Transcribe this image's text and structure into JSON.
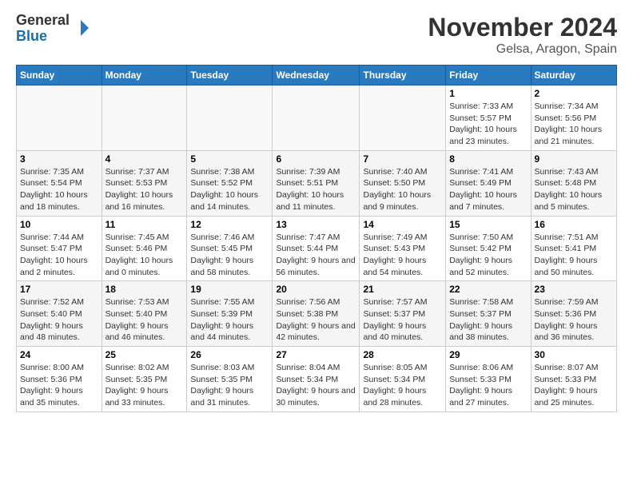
{
  "logo": {
    "general": "General",
    "blue": "Blue"
  },
  "title": "November 2024",
  "subtitle": "Gelsa, Aragon, Spain",
  "days_of_week": [
    "Sunday",
    "Monday",
    "Tuesday",
    "Wednesday",
    "Thursday",
    "Friday",
    "Saturday"
  ],
  "weeks": [
    [
      {
        "day": "",
        "info": ""
      },
      {
        "day": "",
        "info": ""
      },
      {
        "day": "",
        "info": ""
      },
      {
        "day": "",
        "info": ""
      },
      {
        "day": "",
        "info": ""
      },
      {
        "day": "1",
        "info": "Sunrise: 7:33 AM\nSunset: 5:57 PM\nDaylight: 10 hours and 23 minutes."
      },
      {
        "day": "2",
        "info": "Sunrise: 7:34 AM\nSunset: 5:56 PM\nDaylight: 10 hours and 21 minutes."
      }
    ],
    [
      {
        "day": "3",
        "info": "Sunrise: 7:35 AM\nSunset: 5:54 PM\nDaylight: 10 hours and 18 minutes."
      },
      {
        "day": "4",
        "info": "Sunrise: 7:37 AM\nSunset: 5:53 PM\nDaylight: 10 hours and 16 minutes."
      },
      {
        "day": "5",
        "info": "Sunrise: 7:38 AM\nSunset: 5:52 PM\nDaylight: 10 hours and 14 minutes."
      },
      {
        "day": "6",
        "info": "Sunrise: 7:39 AM\nSunset: 5:51 PM\nDaylight: 10 hours and 11 minutes."
      },
      {
        "day": "7",
        "info": "Sunrise: 7:40 AM\nSunset: 5:50 PM\nDaylight: 10 hours and 9 minutes."
      },
      {
        "day": "8",
        "info": "Sunrise: 7:41 AM\nSunset: 5:49 PM\nDaylight: 10 hours and 7 minutes."
      },
      {
        "day": "9",
        "info": "Sunrise: 7:43 AM\nSunset: 5:48 PM\nDaylight: 10 hours and 5 minutes."
      }
    ],
    [
      {
        "day": "10",
        "info": "Sunrise: 7:44 AM\nSunset: 5:47 PM\nDaylight: 10 hours and 2 minutes."
      },
      {
        "day": "11",
        "info": "Sunrise: 7:45 AM\nSunset: 5:46 PM\nDaylight: 10 hours and 0 minutes."
      },
      {
        "day": "12",
        "info": "Sunrise: 7:46 AM\nSunset: 5:45 PM\nDaylight: 9 hours and 58 minutes."
      },
      {
        "day": "13",
        "info": "Sunrise: 7:47 AM\nSunset: 5:44 PM\nDaylight: 9 hours and 56 minutes."
      },
      {
        "day": "14",
        "info": "Sunrise: 7:49 AM\nSunset: 5:43 PM\nDaylight: 9 hours and 54 minutes."
      },
      {
        "day": "15",
        "info": "Sunrise: 7:50 AM\nSunset: 5:42 PM\nDaylight: 9 hours and 52 minutes."
      },
      {
        "day": "16",
        "info": "Sunrise: 7:51 AM\nSunset: 5:41 PM\nDaylight: 9 hours and 50 minutes."
      }
    ],
    [
      {
        "day": "17",
        "info": "Sunrise: 7:52 AM\nSunset: 5:40 PM\nDaylight: 9 hours and 48 minutes."
      },
      {
        "day": "18",
        "info": "Sunrise: 7:53 AM\nSunset: 5:40 PM\nDaylight: 9 hours and 46 minutes."
      },
      {
        "day": "19",
        "info": "Sunrise: 7:55 AM\nSunset: 5:39 PM\nDaylight: 9 hours and 44 minutes."
      },
      {
        "day": "20",
        "info": "Sunrise: 7:56 AM\nSunset: 5:38 PM\nDaylight: 9 hours and 42 minutes."
      },
      {
        "day": "21",
        "info": "Sunrise: 7:57 AM\nSunset: 5:37 PM\nDaylight: 9 hours and 40 minutes."
      },
      {
        "day": "22",
        "info": "Sunrise: 7:58 AM\nSunset: 5:37 PM\nDaylight: 9 hours and 38 minutes."
      },
      {
        "day": "23",
        "info": "Sunrise: 7:59 AM\nSunset: 5:36 PM\nDaylight: 9 hours and 36 minutes."
      }
    ],
    [
      {
        "day": "24",
        "info": "Sunrise: 8:00 AM\nSunset: 5:36 PM\nDaylight: 9 hours and 35 minutes."
      },
      {
        "day": "25",
        "info": "Sunrise: 8:02 AM\nSunset: 5:35 PM\nDaylight: 9 hours and 33 minutes."
      },
      {
        "day": "26",
        "info": "Sunrise: 8:03 AM\nSunset: 5:35 PM\nDaylight: 9 hours and 31 minutes."
      },
      {
        "day": "27",
        "info": "Sunrise: 8:04 AM\nSunset: 5:34 PM\nDaylight: 9 hours and 30 minutes."
      },
      {
        "day": "28",
        "info": "Sunrise: 8:05 AM\nSunset: 5:34 PM\nDaylight: 9 hours and 28 minutes."
      },
      {
        "day": "29",
        "info": "Sunrise: 8:06 AM\nSunset: 5:33 PM\nDaylight: 9 hours and 27 minutes."
      },
      {
        "day": "30",
        "info": "Sunrise: 8:07 AM\nSunset: 5:33 PM\nDaylight: 9 hours and 25 minutes."
      }
    ]
  ]
}
